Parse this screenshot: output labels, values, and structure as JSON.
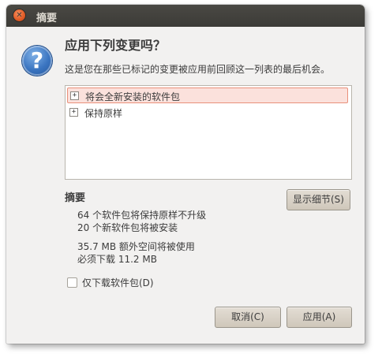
{
  "window": {
    "title": "摘要"
  },
  "dialog": {
    "icon": "question-icon",
    "icon_glyph": "?",
    "heading": "应用下列变更吗？",
    "description": "这是您在那些已标记的变更被应用前回顾这一列表的最后机会。"
  },
  "changes_tree": {
    "items": [
      {
        "expander": "+",
        "label": "将会全新安装的软件包",
        "selected": true
      },
      {
        "expander": "+",
        "label": "保持原样",
        "selected": false
      }
    ]
  },
  "summary": {
    "title": "摘要",
    "details_button": "显示细节(S)",
    "lines": [
      "64 个软件包将保持原样不升级",
      "20 个新软件包将被安装",
      "35.7 MB 额外空间将被使用",
      "必须下载 11.2 MB"
    ]
  },
  "options": {
    "download_only_label": "仅下载软件包(D)",
    "download_only_checked": false
  },
  "buttons": {
    "cancel": "取消(C)",
    "apply": "应用(A)"
  },
  "colors": {
    "titlebar": "#3c3b37",
    "dialog_bg": "#f2f1f0",
    "close_button": "#e05a24",
    "selection_border": "#e9907b",
    "selection_bg": "#fbe1dc"
  }
}
